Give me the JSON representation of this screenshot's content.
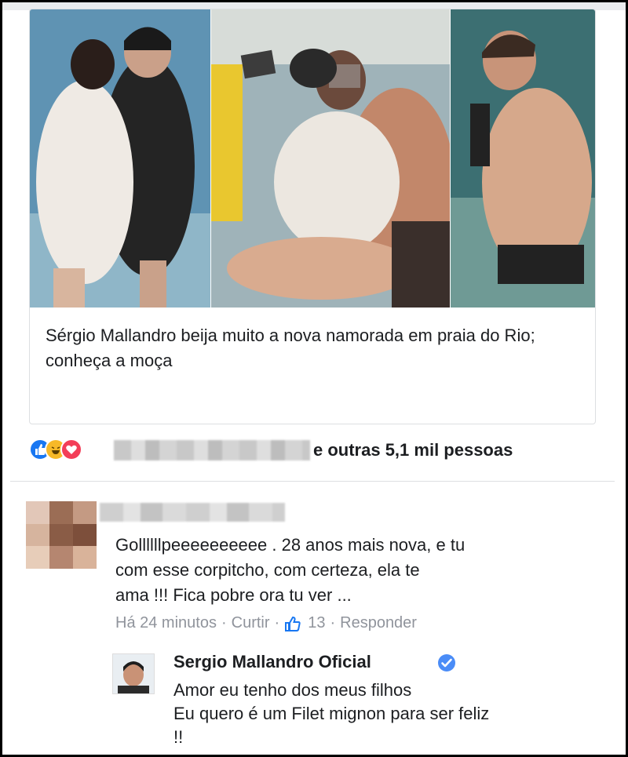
{
  "link_card": {
    "headline": "Sérgio Mallandro beija muito a nova namorada em praia do Rio; conheça a moça"
  },
  "reactions": {
    "icons": [
      "like-icon",
      "haha-icon",
      "love-icon"
    ],
    "others_text": "e outras 5,1 mil pessoas"
  },
  "comment": {
    "text": "Gollllllpeeeeeeeeee . 28 anos mais nova, e tu\ncom esse corpitcho, com certeza, ela te\nama !!! Fica pobre ora tu ver ...",
    "time": "Há 24 minutos",
    "separator": "·",
    "like_action": "Curtir",
    "like_count": "13",
    "reply_action": "Responder"
  },
  "reply": {
    "author": "Sergio Mallandro Oficial",
    "text": "Amor eu tenho dos meus filhos\nEu quero é um Filet mignon para ser feliz\n!!"
  },
  "colors": {
    "facebook_blue": "#1877f2",
    "meta_gray": "#90949c",
    "border": "#dddfe2"
  }
}
